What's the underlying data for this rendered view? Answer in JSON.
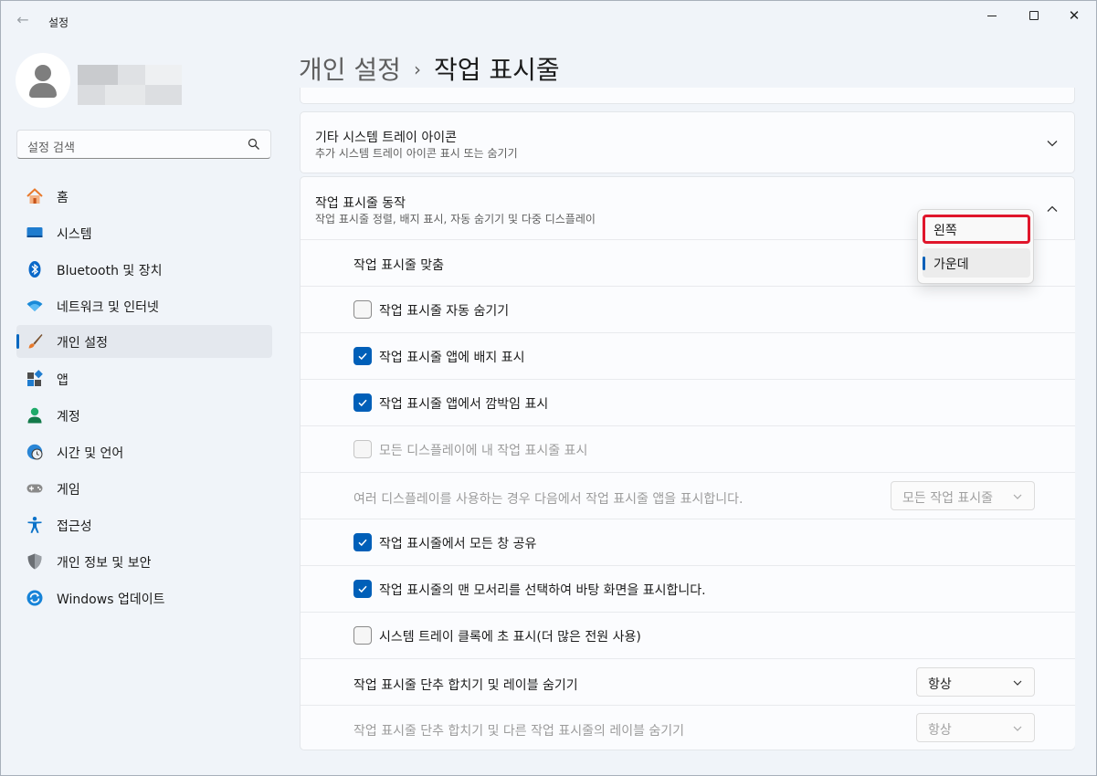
{
  "app": {
    "title": "설정",
    "back_glyph": "←"
  },
  "window_controls": {
    "minimize": "minimize",
    "maximize": "maximize",
    "close": "✕"
  },
  "search": {
    "placeholder": "설정 검색"
  },
  "nav": {
    "items": [
      {
        "label": "홈",
        "icon": "home-icon"
      },
      {
        "label": "시스템",
        "icon": "system-icon"
      },
      {
        "label": "Bluetooth 및 장치",
        "icon": "bluetooth-icon"
      },
      {
        "label": "네트워크 및 인터넷",
        "icon": "wifi-icon"
      },
      {
        "label": "개인 설정",
        "icon": "brush-icon",
        "selected": true
      },
      {
        "label": "앱",
        "icon": "apps-icon"
      },
      {
        "label": "계정",
        "icon": "account-icon"
      },
      {
        "label": "시간 및 언어",
        "icon": "clock-globe-icon"
      },
      {
        "label": "게임",
        "icon": "gamepad-icon"
      },
      {
        "label": "접근성",
        "icon": "accessibility-icon"
      },
      {
        "label": "개인 정보 및 보안",
        "icon": "shield-icon"
      },
      {
        "label": "Windows 업데이트",
        "icon": "update-icon"
      }
    ]
  },
  "breadcrumb": {
    "parent": "개인 설정",
    "separator": "›",
    "current": "작업 표시줄"
  },
  "cards": {
    "tray_icons": {
      "title": "기타 시스템 트레이 아이콘",
      "subtitle": "추가 시스템 트레이 아이콘 표시 또는 숨기기"
    },
    "behaviors": {
      "title": "작업 표시줄 동작",
      "subtitle": "작업 표시줄 정렬, 배지 표시, 자동 숨기기 및 다중 디스플레이"
    }
  },
  "behaviors": {
    "alignment_label": "작업 표시줄 맞춤",
    "auto_hide": {
      "label": "작업 표시줄 자동 숨기기",
      "checked": false
    },
    "badges": {
      "label": "작업 표시줄 앱에 배지 표시",
      "checked": true
    },
    "flashing": {
      "label": "작업 표시줄 앱에서 깜박임 표시",
      "checked": true
    },
    "all_displays": {
      "label": "모든 디스플레이에 내 작업 표시줄 표시",
      "checked": false,
      "disabled": true
    },
    "multi_display": {
      "label": "여러 디스플레이를 사용하는 경우 다음에서 작업 표시줄 앱을 표시합니다.",
      "value": "모든 작업 표시줄",
      "disabled": true
    },
    "share_window": {
      "label": "작업 표시줄에서 모든 창 공유",
      "checked": true
    },
    "far_corner": {
      "label": "작업 표시줄의 맨 모서리를 선택하여 바탕 화면을 표시합니다.",
      "checked": true
    },
    "seconds_clock": {
      "label": "시스템 트레이 클록에 초 표시(더 많은 전원 사용)",
      "checked": false
    },
    "combine_buttons": {
      "label": "작업 표시줄 단추 합치기 및 레이블 숨기기",
      "value": "항상"
    },
    "combine_other": {
      "label": "작업 표시줄 단추 합치기 및 다른 작업 표시줄의 레이블 숨기기",
      "value": "항상",
      "disabled": true
    }
  },
  "alignment_dropdown": {
    "options": [
      "왼쪽",
      "가운데"
    ],
    "selected": "가운데",
    "highlighted": "왼쪽"
  },
  "colors": {
    "accent": "#005fb8",
    "highlight_box": "#e0162b"
  }
}
